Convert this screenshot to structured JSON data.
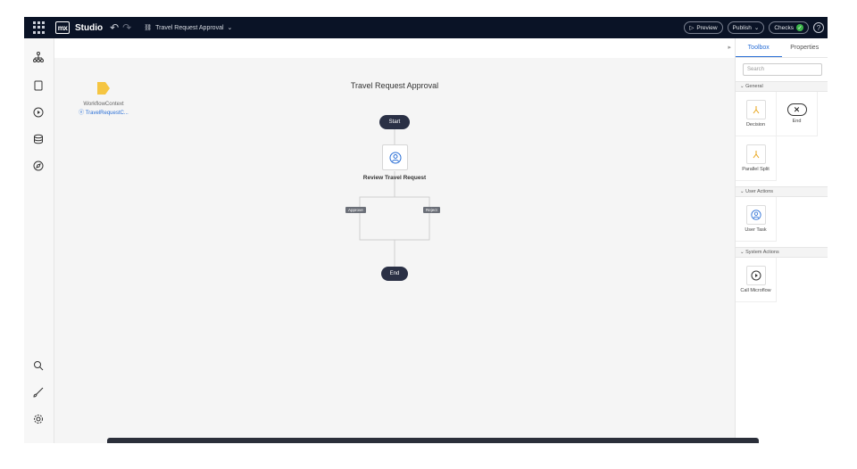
{
  "topbar": {
    "app_name": "Studio",
    "logo_text": "mx",
    "document": "Travel Request Approval",
    "preview_label": "Preview",
    "publish_label": "Publish",
    "checks_label": "Checks",
    "help_label": "?"
  },
  "canvas": {
    "title": "Travel Request Approval",
    "context_label": "WorkflowContext",
    "context_entity": "TravelRequestC...",
    "start_label": "Start",
    "task_label": "Review Travel Request",
    "approve_label": "Approve",
    "reject_label": "Reject",
    "end_label": "End"
  },
  "panel": {
    "tabs": [
      {
        "label": "Toolbox"
      },
      {
        "label": "Properties"
      }
    ],
    "search_placeholder": "Search",
    "sections": [
      {
        "label": "General",
        "items": [
          {
            "label": "Decision"
          },
          {
            "label": "End"
          },
          {
            "label": "Parallel Split"
          }
        ]
      },
      {
        "label": "User Actions",
        "items": [
          {
            "label": "User Task"
          }
        ]
      },
      {
        "label": "System Actions",
        "items": [
          {
            "label": "Call Microflow"
          }
        ]
      }
    ]
  },
  "colors": {
    "topbar_bg": "#0a1326",
    "accent": "#2a6fd6",
    "node_dark": "#2a3045",
    "context_icon": "#f5c542",
    "check_ok": "#3cb54a"
  }
}
